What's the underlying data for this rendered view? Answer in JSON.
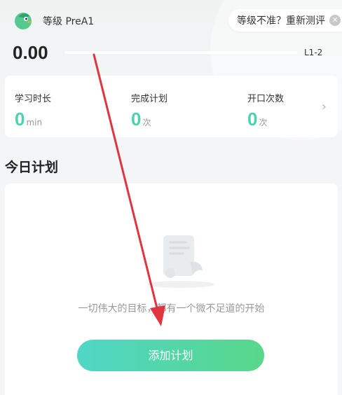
{
  "header": {
    "level_label": "等级 PreA1",
    "retest_text": "等级不准？重新测评",
    "close_icon": "close-icon",
    "avatar_icon": "green-bird-avatar-icon"
  },
  "progress": {
    "score": "0.00",
    "level_target": "L1-2",
    "fill_fraction": 0.0
  },
  "stats": [
    {
      "label": "学习时长",
      "value": "0",
      "unit": "min"
    },
    {
      "label": "完成计划",
      "value": "0",
      "unit": "次"
    },
    {
      "label": "开口次数",
      "value": "0",
      "unit": "次"
    }
  ],
  "section": {
    "title": "今日计划"
  },
  "plan": {
    "empty_illustration": "scroll-document-icon",
    "motto": "一切伟大的目标，都有一个微不足道的开始",
    "add_button_label": "添加计划"
  },
  "colors": {
    "accent": "#4fd1b0",
    "button_start": "#4fd6c6",
    "button_end": "#58d78a",
    "annotation_arrow": "#e0343f"
  }
}
